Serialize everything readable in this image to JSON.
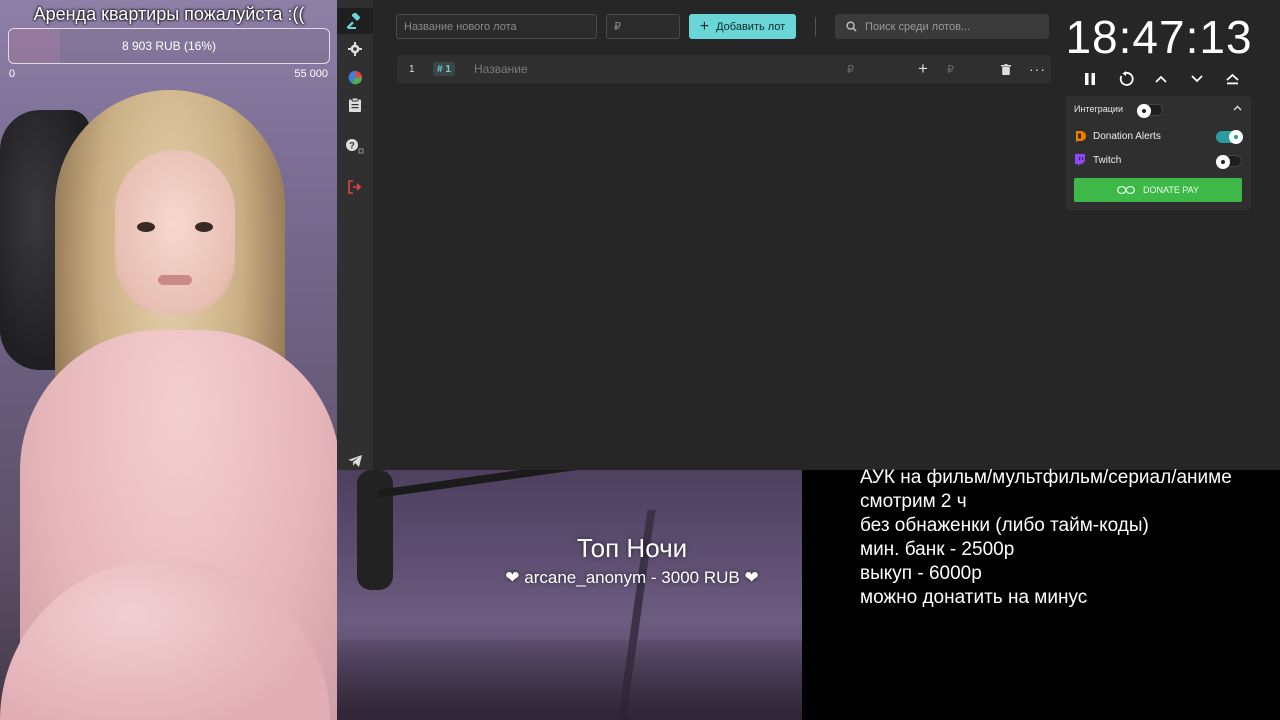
{
  "goal": {
    "title": "Аренда квартиры пожалуйста :((",
    "progress_text": "8 903 RUB (16%)",
    "progress_fraction": 0.16,
    "min": "0",
    "max": "55 000"
  },
  "auction": {
    "new_lot_placeholder": "Название нового лота",
    "currency_symbol": "₽",
    "add_lot_label": "Добавить лот",
    "search_placeholder": "Поиск среди лотов...",
    "lots": [
      {
        "number": "1",
        "id": "# 1",
        "name_placeholder": "Название",
        "plus": "+",
        "more": "···"
      }
    ],
    "accent_color": "#6ad6d8"
  },
  "timer": {
    "value": "18:47:13"
  },
  "integrations": {
    "title": "Интеграции",
    "items": [
      {
        "name": "Donation Alerts",
        "enabled": true
      },
      {
        "name": "Twitch",
        "enabled": false
      }
    ],
    "donate_pay_label": "DONATE PAY"
  },
  "overlay": {
    "top_title": "Топ Ночи",
    "top_donor": "❤ arcane_anonym - 3000 RUB ❤",
    "rules": [
      "АУК на фильм/мультфильм/сериал/аниме",
      "смотрим 2 ч",
      "без обнаженки (либо тайм-коды)",
      "мин. банк - 2500р",
      "выкуп - 6000р",
      "можно донатить на минус"
    ]
  },
  "icons": {
    "sidebar": [
      "gavel-icon",
      "gear-icon",
      "pie-chart-icon",
      "clipboard-icon",
      "help-icon",
      "logout-icon",
      "telegram-icon"
    ],
    "timer_controls": [
      "pause-icon",
      "restart-icon",
      "chevron-up-icon",
      "chevron-down-icon",
      "eject-icon"
    ]
  }
}
